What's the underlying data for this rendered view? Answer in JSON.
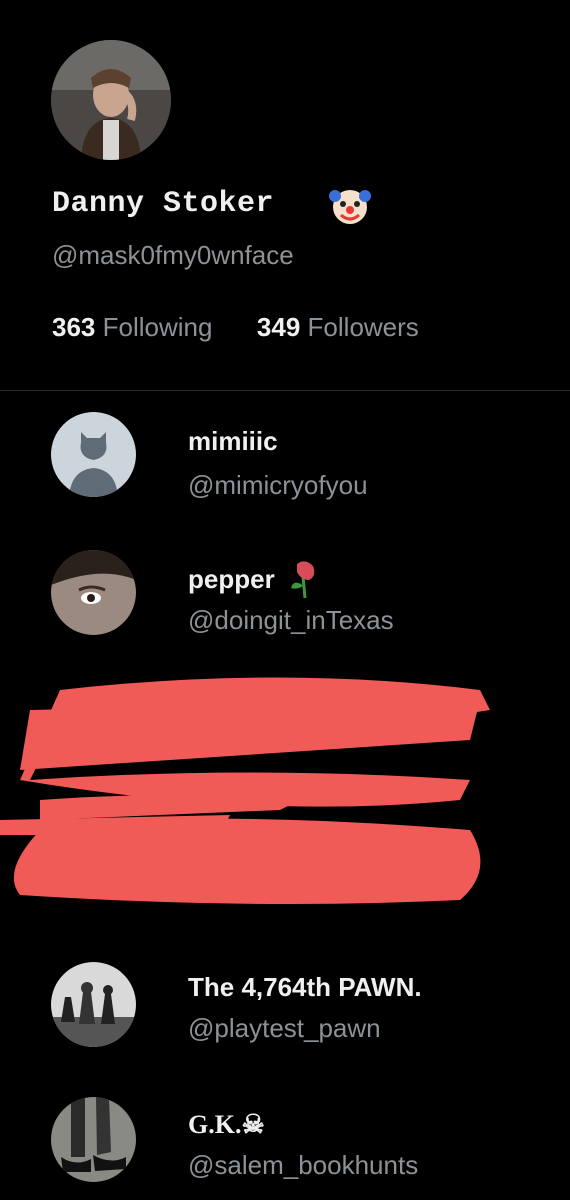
{
  "profile": {
    "display_name": "Danny Stoker",
    "handle": "@mask0fmy0wnface",
    "following_count": "363",
    "following_label": "Following",
    "followers_count": "349",
    "followers_label": "Followers",
    "name_emoji": "clown-face-icon"
  },
  "list": [
    {
      "name": "mimiiic",
      "handle": "@mimicryofyou",
      "avatar": "default-avatar-icon"
    },
    {
      "name": "pepper",
      "handle": "@doingit_inTexas",
      "emoji": "wilted-rose-icon"
    },
    {
      "name": "The 4,764th PAWN.",
      "handle": "@playtest_pawn"
    },
    {
      "name": "G.K.☠",
      "handle": "@salem_bookhunts"
    }
  ],
  "colors": {
    "background": "#000000",
    "primary_text": "#f0f0f0",
    "secondary_text": "#8b9298",
    "scribble": "#f05a57"
  }
}
